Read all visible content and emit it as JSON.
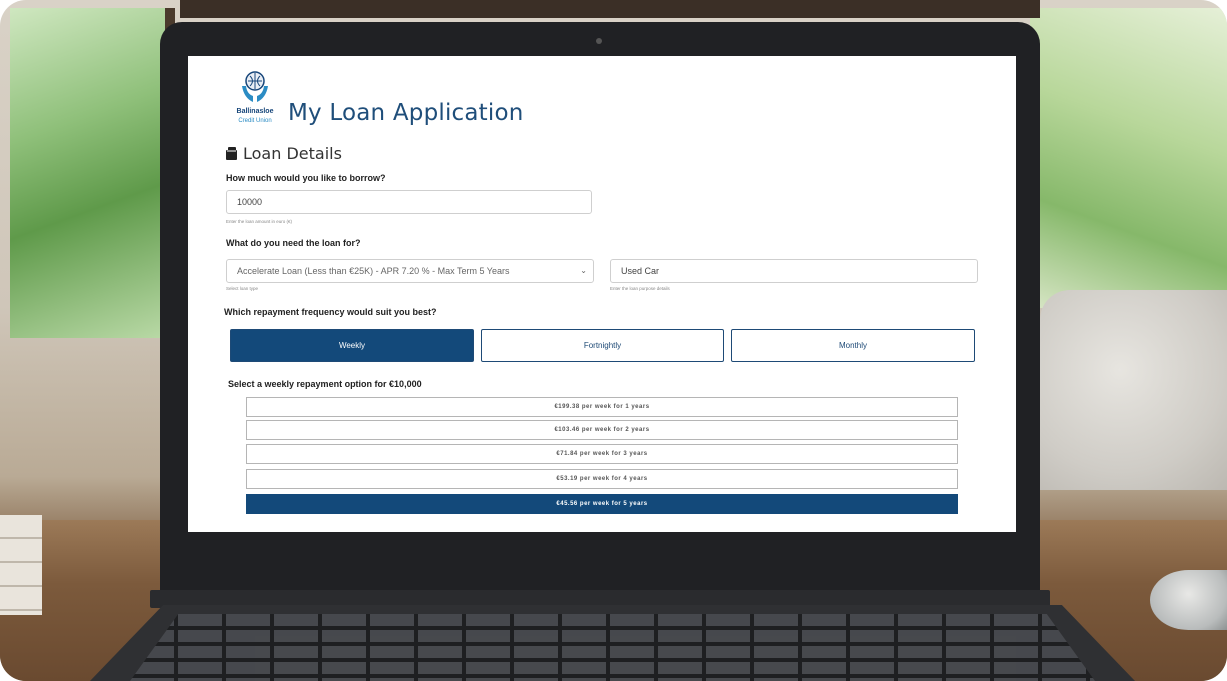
{
  "app": {
    "brand_name": "Ballinasloe",
    "brand_sub": "Credit Union",
    "title": "My Loan Application"
  },
  "section": {
    "title": "Loan Details"
  },
  "borrow": {
    "question": "How much would you like to borrow?",
    "value": "10000",
    "hint": "Enter the loan amount in euro (€)"
  },
  "purpose": {
    "question": "What do you need the loan for?",
    "loan_type_value": "Accelerate Loan (Less than €25K) - APR 7.20 % - Max Term 5 Years",
    "loan_type_hint": "Select loan type",
    "purpose_value": "Used Car",
    "purpose_hint": "Enter the loan purpose details"
  },
  "frequency": {
    "question": "Which repayment frequency would suit you best?",
    "options": [
      "Weekly",
      "Fortnightly",
      "Monthly"
    ],
    "selected": "Weekly"
  },
  "repayment": {
    "question": "Select a weekly repayment option for €10,000",
    "options": [
      "€199.38 per week for 1 years",
      "€103.46 per week for 2 years",
      "€71.84 per week for 3 years",
      "€53.19 per week for 4 years",
      "€45.56 per week for 5 years"
    ],
    "selected_index": 4
  },
  "colors": {
    "accent": "#13497a",
    "title": "#1f4e7a"
  }
}
